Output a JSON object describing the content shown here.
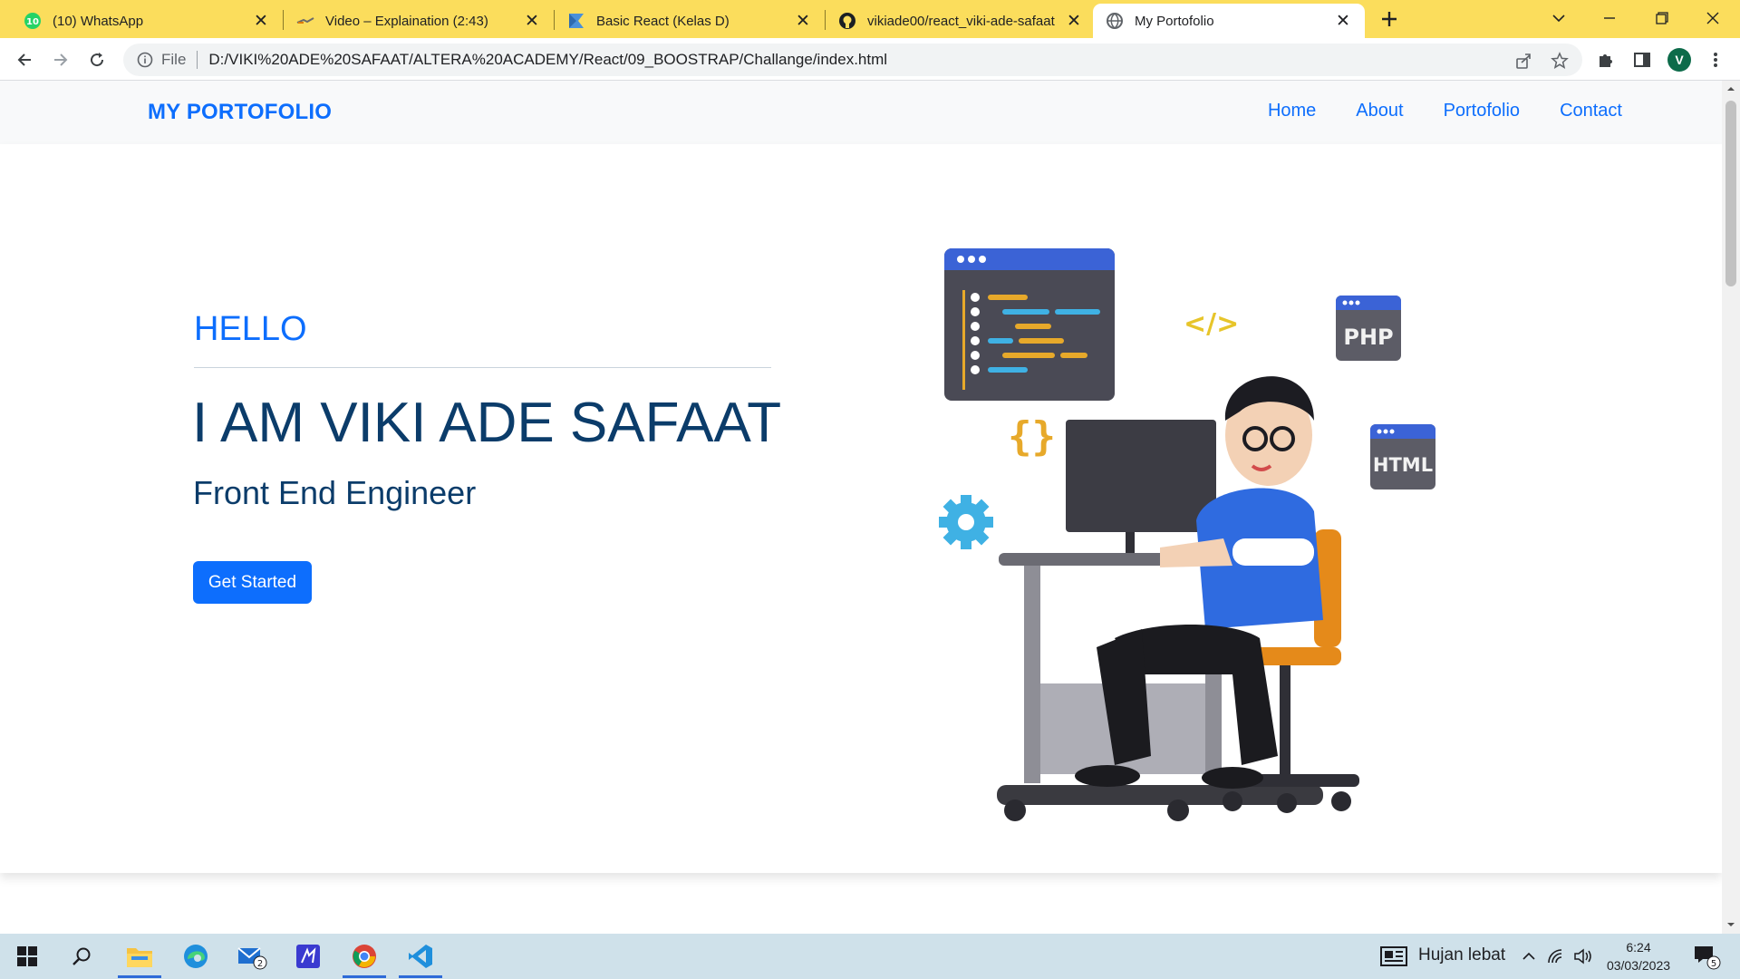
{
  "browser": {
    "tabs": [
      {
        "title": "(10) WhatsApp",
        "icon": "whatsapp-icon",
        "badge": "10"
      },
      {
        "title": "Video – Explaination (2:43)",
        "icon": "video-icon"
      },
      {
        "title": "Basic React (Kelas D)",
        "icon": "flag-icon"
      },
      {
        "title": "vikiade00/react_viki-ade-safaat",
        "icon": "github-icon"
      },
      {
        "title": "My Portofolio",
        "icon": "globe-icon",
        "active": true
      }
    ],
    "address": {
      "scheme": "File",
      "url": "D:/VIKI%20ADE%20SAFAAT/ALTERA%20ACADEMY/React/09_BOOSTRAP/Challange/index.html"
    },
    "profile_initial": "V"
  },
  "site": {
    "brand": "MY PORTOFOLIO",
    "nav": [
      "Home",
      "About",
      "Portofolio",
      "Contact"
    ],
    "hero": {
      "greeting": "HELLO",
      "name": "I AM VIKI ADE SAFAAT",
      "role": "Front End Engineer",
      "cta": "Get Started"
    },
    "illustration_labels": {
      "php": "PHP",
      "html": "HTML",
      "code": "</>",
      "braces": "{}"
    }
  },
  "taskbar": {
    "mail_badge": "2",
    "weather": "Hujan lebat",
    "time": "6:24",
    "date": "03/03/2023",
    "notifications": "5"
  },
  "colors": {
    "tabstrip": "#fbdd5c",
    "brand_blue": "#0d6efd",
    "heading_navy": "#0b3c6a",
    "taskbar": "#cfe1ea"
  }
}
